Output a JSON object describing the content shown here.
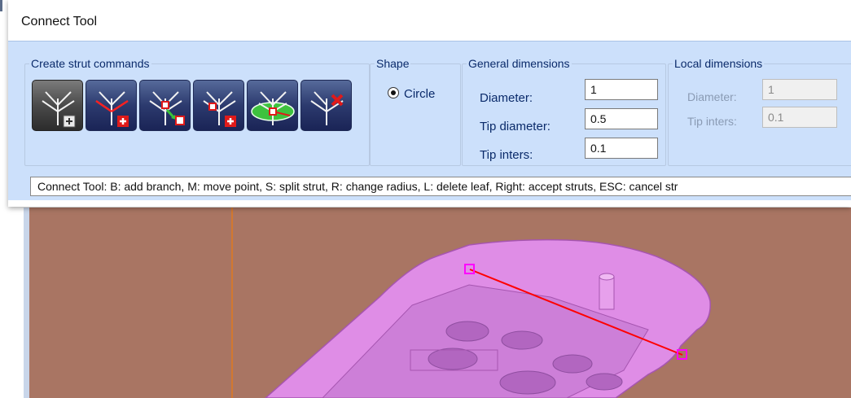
{
  "dialog": {
    "title": "Connect Tool",
    "status_text": "Connect Tool: B: add branch, M: move point, S: split strut, R: change radius, L: delete leaf, Right: accept struts, ESC: cancel str"
  },
  "create_strut": {
    "legend": "Create strut commands",
    "buttons": [
      {
        "name": "add-tree-button",
        "icon": "tree-plus-icon"
      },
      {
        "name": "add-branch-button",
        "icon": "branch-add-icon"
      },
      {
        "name": "move-point-button",
        "icon": "move-point-icon"
      },
      {
        "name": "split-strut-button",
        "icon": "split-strut-icon"
      },
      {
        "name": "change-radius-button",
        "icon": "radius-ellipse-icon"
      },
      {
        "name": "delete-leaf-button",
        "icon": "delete-leaf-icon"
      }
    ]
  },
  "shape": {
    "legend": "Shape",
    "option": "Circle",
    "selected": true
  },
  "general_dimensions": {
    "legend": "General dimensions",
    "diameter_label": "Diameter:",
    "diameter_value": "1",
    "tip_diameter_label": "Tip diameter:",
    "tip_diameter_value": "0.5",
    "tip_inters_label": "Tip inters:",
    "tip_inters_value": "0.1"
  },
  "local_dimensions": {
    "legend": "Local dimensions",
    "diameter_label": "Diameter:",
    "diameter_value": "1",
    "tip_inters_label": "Tip inters:",
    "tip_inters_value": "0.1"
  },
  "colors": {
    "dialog_bg": "#cce0fb",
    "viewport_bg": "#a97563",
    "part": "#df8de6",
    "strut": "#ff0000",
    "marker": "#ff00ff"
  }
}
